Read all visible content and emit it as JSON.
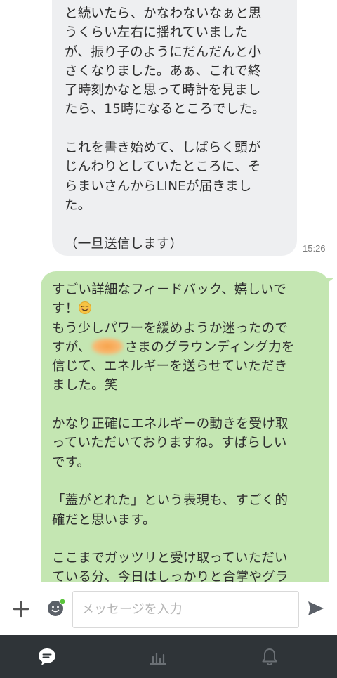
{
  "messages": {
    "incoming": {
      "text": "と続いたら、かなわないなぁと思\nうくらい左右に揺れていました\nが、振り子のようにだんだんと小\nさくなりました。あぁ、これで終\n了時刻かなと思って時計を見まし\nたら、15時になるところでした。\n\nこれを書き始めて、しばらく頭が\nじんわりとしていたところに、そ\nらまいさんからLINEが届きまし\nた。\n\n（一旦送信します）",
      "time": "15:26"
    },
    "outgoing": {
      "line1": "すごい詳細なフィードバック、嬉しいで\nす！",
      "line2": "\nもう少しパワーを緩めようか迷ったので\nすが、",
      "line3": "さまのグラウンディング力を\n信じて、エネルギーを送らせていただき\nました。笑\n\nかなり正確にエネルギーの動きを受け取\nっていただいておりますね。すばらしい\nです。\n\n「蓋がとれた」という表現も、すごく的\n確だと思います。\n\nここまでガッツリと受け取っていただい\nている分、今日はしっかりと合掌やグラ",
      "emoji": "smiling-face-emoji"
    }
  },
  "input_bar": {
    "placeholder": "メッセージを入力"
  },
  "icons": {
    "plus": "plus-icon",
    "emoji": "emoji-icon",
    "send": "send-icon"
  },
  "nav": {
    "items": [
      "chat-icon",
      "chart-icon",
      "bell-icon"
    ]
  },
  "colors": {
    "incoming_bubble": "#eeeff1",
    "outgoing_bubble": "#c4e6b2",
    "nav_background": "#2f3438",
    "online_dot": "#5ac43c"
  }
}
